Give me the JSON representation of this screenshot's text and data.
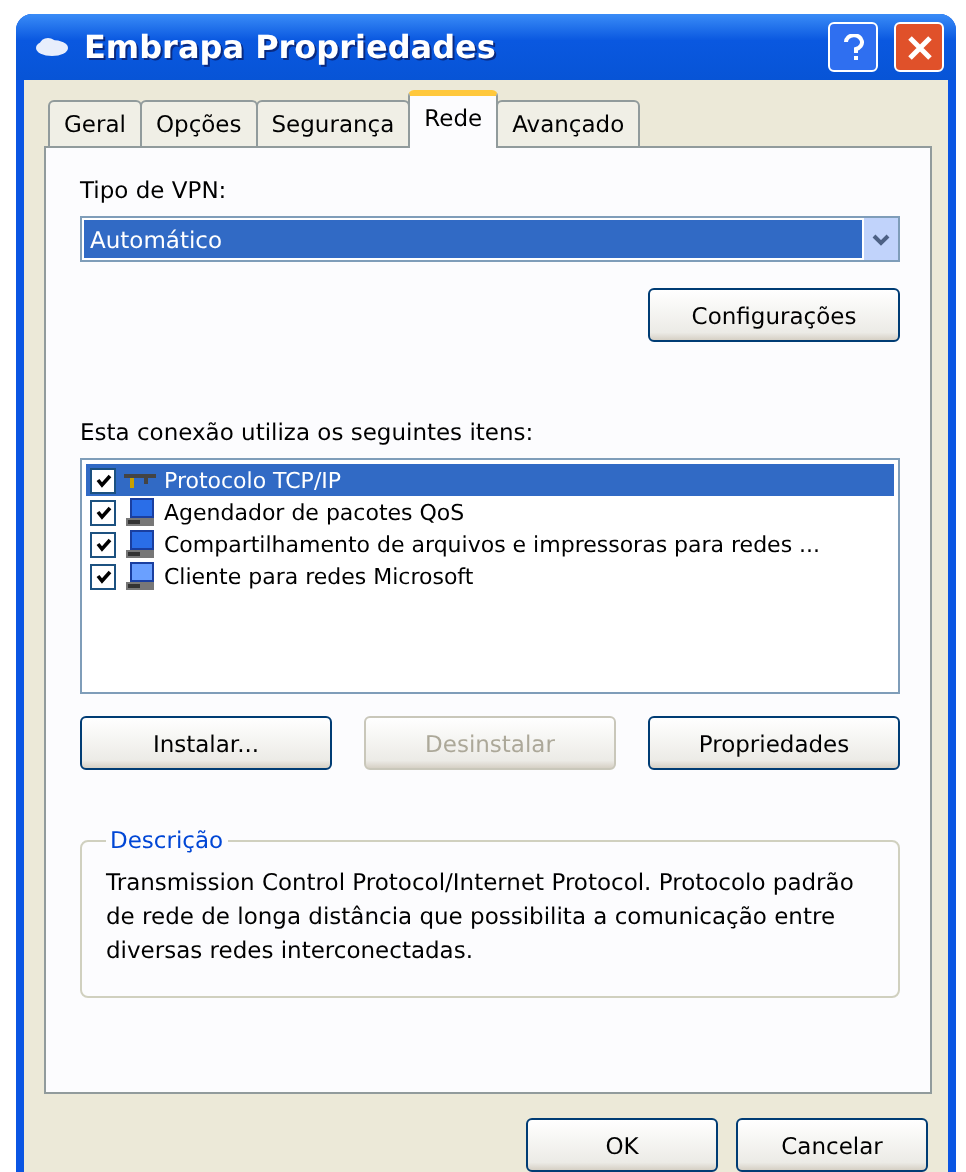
{
  "window": {
    "title": "Embrapa Propriedades"
  },
  "tabs": [
    {
      "label": "Geral",
      "selected": false
    },
    {
      "label": "Opções",
      "selected": false
    },
    {
      "label": "Segurança",
      "selected": false
    },
    {
      "label": "Rede",
      "selected": true
    },
    {
      "label": "Avançado",
      "selected": false
    }
  ],
  "vpn": {
    "label": "Tipo de VPN:",
    "value": "Automático"
  },
  "config_button": "Configurações",
  "items_label": "Esta conexão utiliza os seguintes itens:",
  "items": [
    {
      "label": "Protocolo TCP/IP",
      "kind": "protocol",
      "checked": true,
      "selected": true
    },
    {
      "label": "Agendador de pacotes QoS",
      "kind": "service",
      "checked": true,
      "selected": false
    },
    {
      "label": "Compartilhamento de arquivos e impressoras para redes ...",
      "kind": "service",
      "checked": true,
      "selected": false
    },
    {
      "label": "Cliente para redes Microsoft",
      "kind": "client",
      "checked": true,
      "selected": false
    }
  ],
  "item_buttons": [
    {
      "label": "Instalar...",
      "disabled": false
    },
    {
      "label": "Desinstalar",
      "disabled": true
    },
    {
      "label": "Propriedades",
      "disabled": false
    }
  ],
  "description": {
    "title": "Descrição",
    "text": "Transmission Control Protocol/Internet Protocol. Protocolo padrão de rede de longa distância que possibilita a comunicação entre diversas redes interconectadas."
  },
  "buttons": [
    "OK",
    "Cancelar"
  ]
}
